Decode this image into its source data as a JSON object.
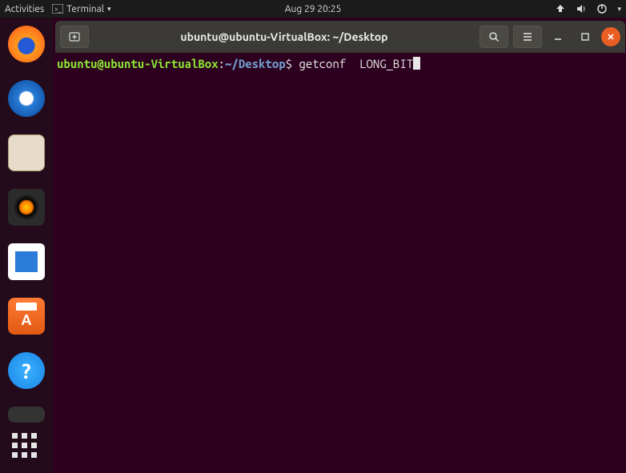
{
  "topbar": {
    "activities_label": "Activities",
    "app_menu_label": "Terminal",
    "clock": "Aug 29  20:25"
  },
  "titlebar": {
    "title": "ubuntu@ubuntu-VirtualBox: ~/Desktop"
  },
  "terminal": {
    "prompt_user": "ubuntu@ubuntu-VirtualBox",
    "prompt_sep1": ":",
    "prompt_path": "~/Desktop",
    "prompt_sep2": "$ ",
    "command": "getconf  LONG_BIT"
  },
  "dock": {
    "items": [
      "firefox",
      "thunderbird",
      "files",
      "rhythmbox",
      "libreoffice-writer",
      "ubuntu-software",
      "help"
    ]
  }
}
